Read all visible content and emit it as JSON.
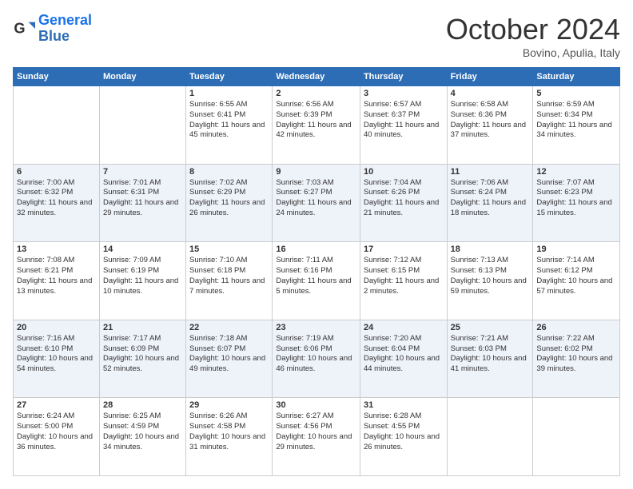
{
  "header": {
    "logo_general": "General",
    "logo_blue": "Blue",
    "month": "October 2024",
    "location": "Bovino, Apulia, Italy"
  },
  "days_of_week": [
    "Sunday",
    "Monday",
    "Tuesday",
    "Wednesday",
    "Thursday",
    "Friday",
    "Saturday"
  ],
  "weeks": [
    [
      {
        "day": "",
        "info": ""
      },
      {
        "day": "",
        "info": ""
      },
      {
        "day": "1",
        "info": "Sunrise: 6:55 AM\nSunset: 6:41 PM\nDaylight: 11 hours and 45 minutes."
      },
      {
        "day": "2",
        "info": "Sunrise: 6:56 AM\nSunset: 6:39 PM\nDaylight: 11 hours and 42 minutes."
      },
      {
        "day": "3",
        "info": "Sunrise: 6:57 AM\nSunset: 6:37 PM\nDaylight: 11 hours and 40 minutes."
      },
      {
        "day": "4",
        "info": "Sunrise: 6:58 AM\nSunset: 6:36 PM\nDaylight: 11 hours and 37 minutes."
      },
      {
        "day": "5",
        "info": "Sunrise: 6:59 AM\nSunset: 6:34 PM\nDaylight: 11 hours and 34 minutes."
      }
    ],
    [
      {
        "day": "6",
        "info": "Sunrise: 7:00 AM\nSunset: 6:32 PM\nDaylight: 11 hours and 32 minutes."
      },
      {
        "day": "7",
        "info": "Sunrise: 7:01 AM\nSunset: 6:31 PM\nDaylight: 11 hours and 29 minutes."
      },
      {
        "day": "8",
        "info": "Sunrise: 7:02 AM\nSunset: 6:29 PM\nDaylight: 11 hours and 26 minutes."
      },
      {
        "day": "9",
        "info": "Sunrise: 7:03 AM\nSunset: 6:27 PM\nDaylight: 11 hours and 24 minutes."
      },
      {
        "day": "10",
        "info": "Sunrise: 7:04 AM\nSunset: 6:26 PM\nDaylight: 11 hours and 21 minutes."
      },
      {
        "day": "11",
        "info": "Sunrise: 7:06 AM\nSunset: 6:24 PM\nDaylight: 11 hours and 18 minutes."
      },
      {
        "day": "12",
        "info": "Sunrise: 7:07 AM\nSunset: 6:23 PM\nDaylight: 11 hours and 15 minutes."
      }
    ],
    [
      {
        "day": "13",
        "info": "Sunrise: 7:08 AM\nSunset: 6:21 PM\nDaylight: 11 hours and 13 minutes."
      },
      {
        "day": "14",
        "info": "Sunrise: 7:09 AM\nSunset: 6:19 PM\nDaylight: 11 hours and 10 minutes."
      },
      {
        "day": "15",
        "info": "Sunrise: 7:10 AM\nSunset: 6:18 PM\nDaylight: 11 hours and 7 minutes."
      },
      {
        "day": "16",
        "info": "Sunrise: 7:11 AM\nSunset: 6:16 PM\nDaylight: 11 hours and 5 minutes."
      },
      {
        "day": "17",
        "info": "Sunrise: 7:12 AM\nSunset: 6:15 PM\nDaylight: 11 hours and 2 minutes."
      },
      {
        "day": "18",
        "info": "Sunrise: 7:13 AM\nSunset: 6:13 PM\nDaylight: 10 hours and 59 minutes."
      },
      {
        "day": "19",
        "info": "Sunrise: 7:14 AM\nSunset: 6:12 PM\nDaylight: 10 hours and 57 minutes."
      }
    ],
    [
      {
        "day": "20",
        "info": "Sunrise: 7:16 AM\nSunset: 6:10 PM\nDaylight: 10 hours and 54 minutes."
      },
      {
        "day": "21",
        "info": "Sunrise: 7:17 AM\nSunset: 6:09 PM\nDaylight: 10 hours and 52 minutes."
      },
      {
        "day": "22",
        "info": "Sunrise: 7:18 AM\nSunset: 6:07 PM\nDaylight: 10 hours and 49 minutes."
      },
      {
        "day": "23",
        "info": "Sunrise: 7:19 AM\nSunset: 6:06 PM\nDaylight: 10 hours and 46 minutes."
      },
      {
        "day": "24",
        "info": "Sunrise: 7:20 AM\nSunset: 6:04 PM\nDaylight: 10 hours and 44 minutes."
      },
      {
        "day": "25",
        "info": "Sunrise: 7:21 AM\nSunset: 6:03 PM\nDaylight: 10 hours and 41 minutes."
      },
      {
        "day": "26",
        "info": "Sunrise: 7:22 AM\nSunset: 6:02 PM\nDaylight: 10 hours and 39 minutes."
      }
    ],
    [
      {
        "day": "27",
        "info": "Sunrise: 6:24 AM\nSunset: 5:00 PM\nDaylight: 10 hours and 36 minutes."
      },
      {
        "day": "28",
        "info": "Sunrise: 6:25 AM\nSunset: 4:59 PM\nDaylight: 10 hours and 34 minutes."
      },
      {
        "day": "29",
        "info": "Sunrise: 6:26 AM\nSunset: 4:58 PM\nDaylight: 10 hours and 31 minutes."
      },
      {
        "day": "30",
        "info": "Sunrise: 6:27 AM\nSunset: 4:56 PM\nDaylight: 10 hours and 29 minutes."
      },
      {
        "day": "31",
        "info": "Sunrise: 6:28 AM\nSunset: 4:55 PM\nDaylight: 10 hours and 26 minutes."
      },
      {
        "day": "",
        "info": ""
      },
      {
        "day": "",
        "info": ""
      }
    ]
  ]
}
